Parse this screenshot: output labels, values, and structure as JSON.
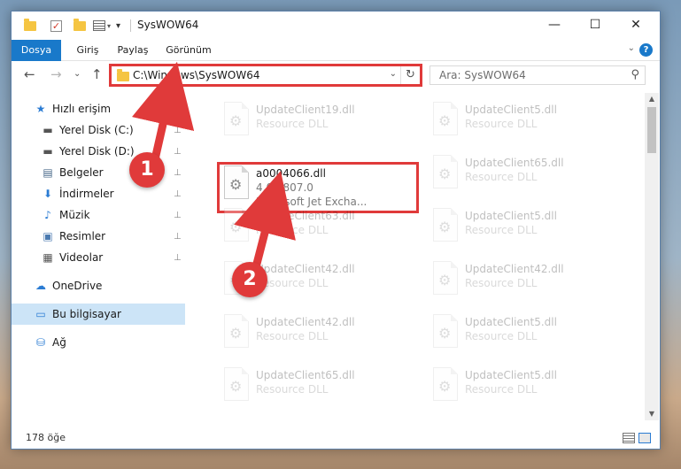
{
  "window": {
    "title": "SysWOW64"
  },
  "titlebar": {
    "quick_access": [
      "folder-icon",
      "properties-check-icon",
      "new-folder-icon",
      "properties-icon"
    ],
    "minimize": "—",
    "maximize": "☐",
    "close": "✕"
  },
  "ribbon": {
    "tabs": [
      {
        "label": "Dosya"
      },
      {
        "label": "Giriş"
      },
      {
        "label": "Paylaş"
      },
      {
        "label": "Görünüm"
      }
    ],
    "help": "?",
    "collapse": "⌄"
  },
  "nav": {
    "back": "←",
    "forward": "→",
    "recent": "⌄",
    "up": "↑",
    "address": "C:\\Windows\\SysWOW64",
    "refresh": "↻",
    "search_placeholder": "Ara: SysWOW64",
    "search_icon": "⚲"
  },
  "sidebar": {
    "items": [
      {
        "label": "Hızlı erişim",
        "icon": "★"
      },
      {
        "label": "Yerel Disk (C:)",
        "icon": "▬",
        "pin": "📌"
      },
      {
        "label": "Yerel Disk (D:)",
        "icon": "▬",
        "pin": "📌"
      },
      {
        "label": "Belgeler",
        "icon": "▤",
        "pin": "📌"
      },
      {
        "label": "İndirmeler",
        "icon": "⬇",
        "pin": "📌"
      },
      {
        "label": "Müzik",
        "icon": "♪",
        "pin": "📌"
      },
      {
        "label": "Resimler",
        "icon": "▣",
        "pin": "📌"
      },
      {
        "label": "Videolar",
        "icon": "▦",
        "pin": "📌"
      },
      {
        "label": "OneDrive",
        "icon": "☁"
      },
      {
        "label": "Bu bilgisayar",
        "icon": "▭"
      },
      {
        "label": "Ağ",
        "icon": "⛁"
      }
    ]
  },
  "files": [
    {
      "name": "UpdateClient19.dll",
      "sub": "Resource DLL"
    },
    {
      "name": "UpdateClient5.dll",
      "sub": "Resource DLL"
    },
    {
      "name": "a0004066.dll",
      "sub": "4.0.6807.0",
      "sub2": "Microsoft Jet Excha..."
    },
    {
      "name": "UpdateClient65.dll",
      "sub": "Resource DLL"
    },
    {
      "name": "UpdateClient63.dll",
      "sub": "Resource DLL"
    },
    {
      "name": "UpdateClient5.dll",
      "sub": "Resource DLL"
    },
    {
      "name": "UpdateClient42.dll",
      "sub": "Resource DLL"
    },
    {
      "name": "UpdateClient42.dll",
      "sub": "Resource DLL"
    },
    {
      "name": "UpdateClient42.dll",
      "sub": "Resource DLL"
    },
    {
      "name": "UpdateClient5.dll",
      "sub": "Resource DLL"
    },
    {
      "name": "UpdateClient65.dll",
      "sub": "Resource DLL"
    },
    {
      "name": "UpdateClient5.dll",
      "sub": "Resource DLL"
    }
  ],
  "status": {
    "count": "178 öğe"
  },
  "annotations": {
    "step1": "1",
    "step2": "2",
    "color": "#e03a3a"
  },
  "colors": {
    "accent": "#1979ca",
    "selection": "#cce4f7",
    "highlight": "#e03a3a"
  }
}
